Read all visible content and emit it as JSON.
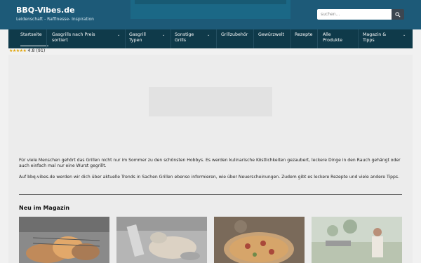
{
  "site": {
    "title": "BBQ-Vibes.de",
    "tagline": "Leidenschaft - Raffinesse- Inspiration"
  },
  "search": {
    "placeholder": "suchen...",
    "button_icon": "search-icon"
  },
  "nav": {
    "items": [
      {
        "label": "Startseite",
        "active": true,
        "dropdown": false
      },
      {
        "label": "Gasgrills nach Preis sortiert",
        "dropdown": true
      },
      {
        "label": "Gasgrill Typen",
        "dropdown": true
      },
      {
        "label": "Sonstige Grills",
        "dropdown": true
      },
      {
        "label": "Grillzubehör",
        "dropdown": false
      },
      {
        "label": "Gewürzwelt",
        "dropdown": false
      },
      {
        "label": "Rezepte",
        "dropdown": false
      },
      {
        "label": "Alle Produkte",
        "dropdown": false
      },
      {
        "label": "Magazin & Tipps",
        "dropdown": true
      }
    ]
  },
  "rating": {
    "stars": "★★★★★",
    "value": "4.8 (91)"
  },
  "intro": {
    "p1": "Für viele Menschen gehört das Grillen nicht nur im Sommer zu den schönsten Hobbys. Es werden kulinarische Köstlichkeiten gezaubert, leckere Dinge in den Rauch gehängt oder auch einfach mal nur eine Wurst gegrillt.",
    "p2": "Auf bbq-vibes.de werden wir dich über aktuelle Trends in Sachen Grillen ebenso informieren, wie über Neuerscheinungen. Zudem gibt es leckere Rezepte und viele andere Tipps."
  },
  "magazine": {
    "heading": "Neu im Magazin"
  },
  "colors": {
    "header": "#1d5a78",
    "nav": "#0f3a4a",
    "background": "#f1f1f1"
  }
}
